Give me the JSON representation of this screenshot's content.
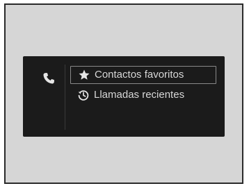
{
  "phone_menu": {
    "items": [
      {
        "label": "Contactos favoritos",
        "icon": "star-icon",
        "selected": true
      },
      {
        "label": "Llamadas recientes",
        "icon": "recent-calls-icon",
        "selected": false
      }
    ],
    "side_icon": "phone-icon"
  }
}
